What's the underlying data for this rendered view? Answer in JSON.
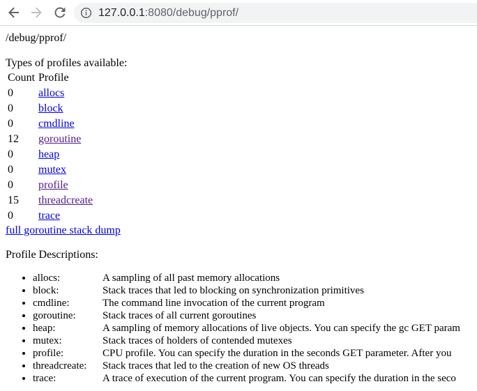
{
  "browser": {
    "url_host": "127.0.0.1",
    "url_rest": ":8080/debug/pprof/",
    "back_icon": "back-arrow-icon",
    "forward_icon": "forward-arrow-icon",
    "reload_icon": "reload-icon",
    "site_info_icon": "info-circle-icon"
  },
  "page": {
    "path": "/debug/pprof/",
    "types_heading": "Types of profiles available:",
    "table_headers": {
      "count": "Count",
      "profile": "Profile"
    },
    "profiles": [
      {
        "count": "0",
        "name": "allocs",
        "visited": false
      },
      {
        "count": "0",
        "name": "block",
        "visited": false
      },
      {
        "count": "0",
        "name": "cmdline",
        "visited": false
      },
      {
        "count": "12",
        "name": "goroutine",
        "visited": true
      },
      {
        "count": "0",
        "name": "heap",
        "visited": false
      },
      {
        "count": "0",
        "name": "mutex",
        "visited": false
      },
      {
        "count": "0",
        "name": "profile",
        "visited": true
      },
      {
        "count": "15",
        "name": "threadcreate",
        "visited": true
      },
      {
        "count": "0",
        "name": "trace",
        "visited": false
      }
    ],
    "full_dump_link": "full goroutine stack dump",
    "descriptions_heading": "Profile Descriptions:",
    "descriptions": [
      {
        "name": "allocs:",
        "text": "A sampling of all past memory allocations"
      },
      {
        "name": "block:",
        "text": "Stack traces that led to blocking on synchronization primitives"
      },
      {
        "name": "cmdline:",
        "text": "The command line invocation of the current program"
      },
      {
        "name": "goroutine:",
        "text": "Stack traces of all current goroutines"
      },
      {
        "name": "heap:",
        "text": "A sampling of memory allocations of live objects. You can specify the gc GET param"
      },
      {
        "name": "mutex:",
        "text": "Stack traces of holders of contended mutexes"
      },
      {
        "name": "profile:",
        "text": "CPU profile. You can specify the duration in the seconds GET parameter. After you"
      },
      {
        "name": "threadcreate:",
        "text": "Stack traces that led to the creation of new OS threads"
      },
      {
        "name": "trace:",
        "text": "A trace of execution of the current program. You can specify the duration in the seco"
      }
    ]
  },
  "colors": {
    "link": "#0000ee",
    "link_visited": "#551a8b",
    "omnibox_bg": "#f1f3f4",
    "nav_icon": "#5f6368",
    "nav_icon_disabled": "#bdc1c6"
  }
}
